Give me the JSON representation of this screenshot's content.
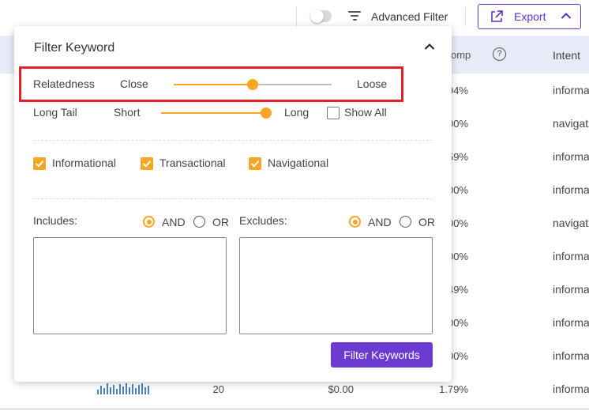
{
  "toolbar": {
    "advanced_filter_label": "Advanced Filter",
    "export_label": "Export",
    "toggle_on": false
  },
  "table": {
    "header": {
      "comp": "omp",
      "help": "?",
      "intent": "Intent"
    },
    "rows": [
      {
        "comp": "94%",
        "intent": "informa"
      },
      {
        "comp": "00%",
        "intent": "navigat"
      },
      {
        "comp": "59%",
        "intent": "informa"
      },
      {
        "comp": "00%",
        "intent": "informa"
      },
      {
        "comp": "00%",
        "intent": "navigat"
      },
      {
        "comp": "00%",
        "intent": "informa"
      },
      {
        "comp": "49%",
        "intent": "informa"
      },
      {
        "comp": "00%",
        "intent": "informa"
      },
      {
        "comp": "00%",
        "intent": "informa"
      }
    ],
    "last_row": {
      "volume": "20",
      "cpc": "$0.00",
      "comp": "1.79%",
      "intent": "informa"
    }
  },
  "panel": {
    "title": "Filter Keyword",
    "relatedness": {
      "label": "Relatedness",
      "min_label": "Close",
      "max_label": "Loose",
      "value_fraction": 0.5
    },
    "long_tail": {
      "label": "Long Tail",
      "min_label": "Short",
      "max_label": "Long",
      "value_fraction": 1.0,
      "show_all_label": "Show All",
      "show_all_checked": false
    },
    "intents": [
      {
        "label": "Informational",
        "checked": true
      },
      {
        "label": "Transactional",
        "checked": true
      },
      {
        "label": "Navigational",
        "checked": true
      }
    ],
    "includes": {
      "label": "Includes:",
      "and_label": "AND",
      "or_label": "OR",
      "selected": "AND",
      "value": ""
    },
    "excludes": {
      "label": "Excludes:",
      "and_label": "AND",
      "or_label": "OR",
      "selected": "AND",
      "value": ""
    },
    "submit_label": "Filter Keywords"
  },
  "colors": {
    "accent": "#f5a623",
    "brand": "#6a3ad1",
    "highlight": "#e5202a",
    "header_bg": "#e8ebf7"
  }
}
